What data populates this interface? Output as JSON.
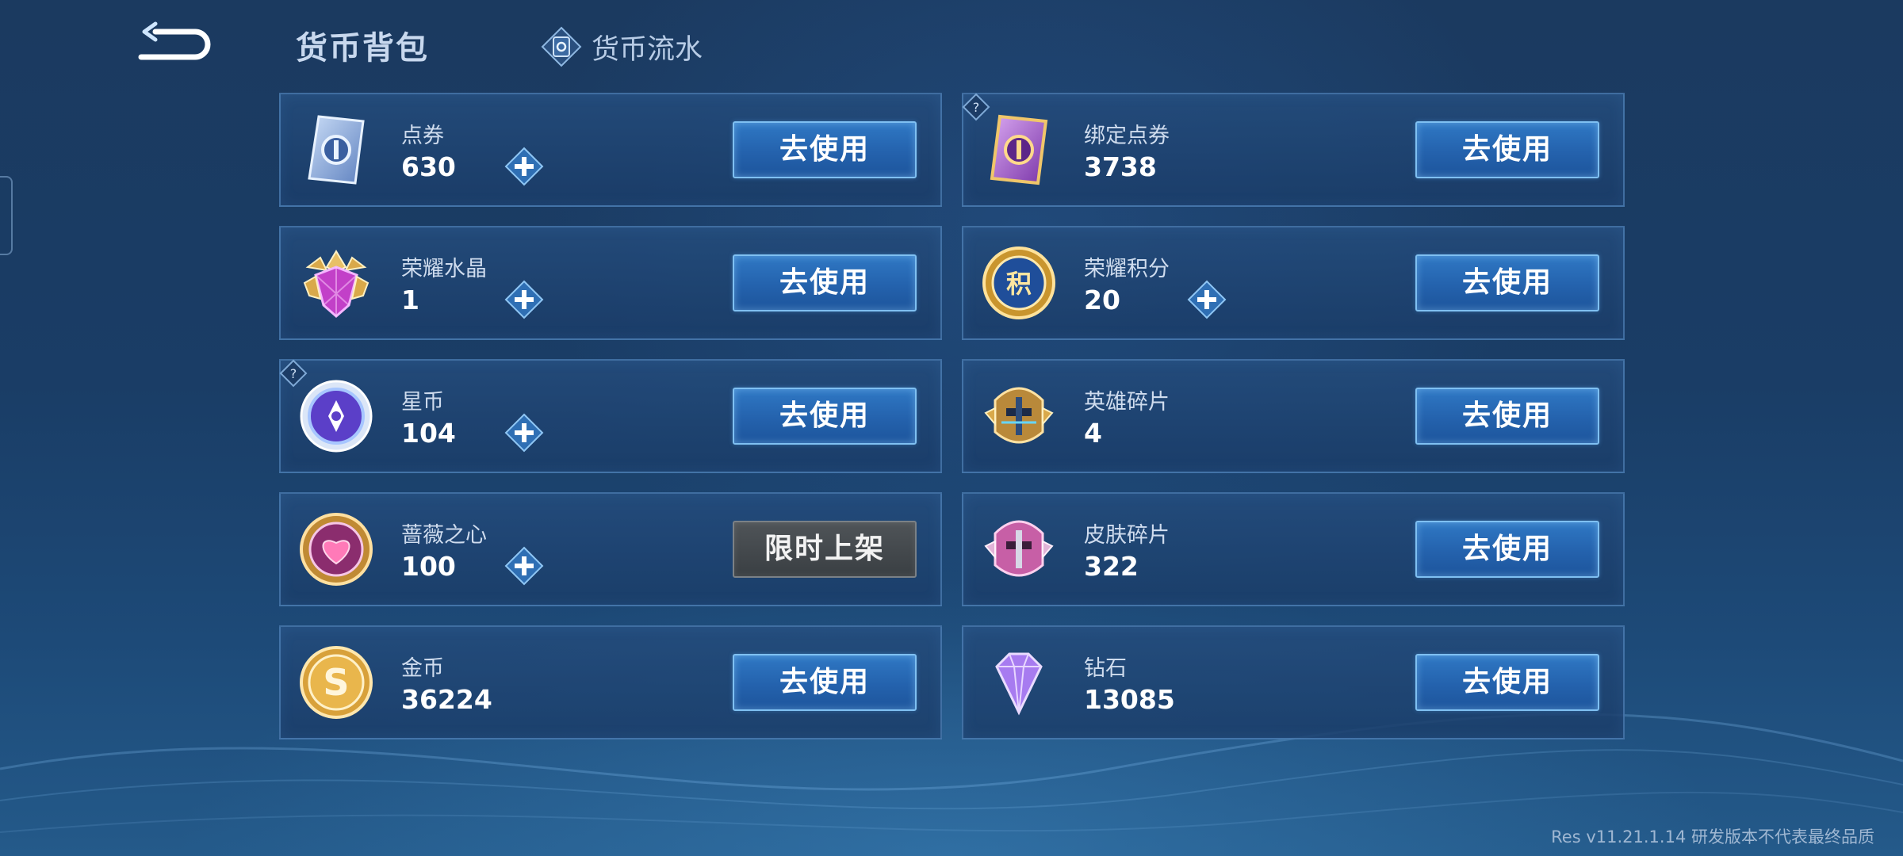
{
  "header": {
    "title": "货币背包",
    "ledger_label": "货币流水"
  },
  "currencies": [
    {
      "name": "点券",
      "amount": "630",
      "action": "去使用",
      "icon": "ticket-card-icon",
      "plus": true,
      "help": false
    },
    {
      "name": "绑定点券",
      "amount": "3738",
      "action": "去使用",
      "icon": "bound-ticket-card-icon",
      "plus": false,
      "help": true
    },
    {
      "name": "荣耀水晶",
      "amount": "1",
      "action": "去使用",
      "icon": "glory-crystal-icon",
      "plus": true,
      "help": false
    },
    {
      "name": "荣耀积分",
      "amount": "20",
      "action": "去使用",
      "icon": "glory-points-icon",
      "plus": true,
      "help": false
    },
    {
      "name": "星币",
      "amount": "104",
      "action": "去使用",
      "icon": "star-coin-icon",
      "plus": true,
      "help": true
    },
    {
      "name": "英雄碎片",
      "amount": "4",
      "action": "去使用",
      "icon": "hero-fragment-icon",
      "plus": false,
      "help": false
    },
    {
      "name": "蔷薇之心",
      "amount": "100",
      "action": "限时上架",
      "icon": "rose-heart-icon",
      "plus": true,
      "help": false,
      "disabled": true
    },
    {
      "name": "皮肤碎片",
      "amount": "322",
      "action": "去使用",
      "icon": "skin-fragment-icon",
      "plus": false,
      "help": false
    },
    {
      "name": "金币",
      "amount": "36224",
      "action": "去使用",
      "icon": "gold-coin-icon",
      "plus": false,
      "help": false
    },
    {
      "name": "钻石",
      "amount": "13085",
      "action": "去使用",
      "icon": "diamond-icon",
      "plus": false,
      "help": false
    }
  ],
  "footer": {
    "version": "Res v11.21.1.14 研发版本不代表最终品质"
  }
}
